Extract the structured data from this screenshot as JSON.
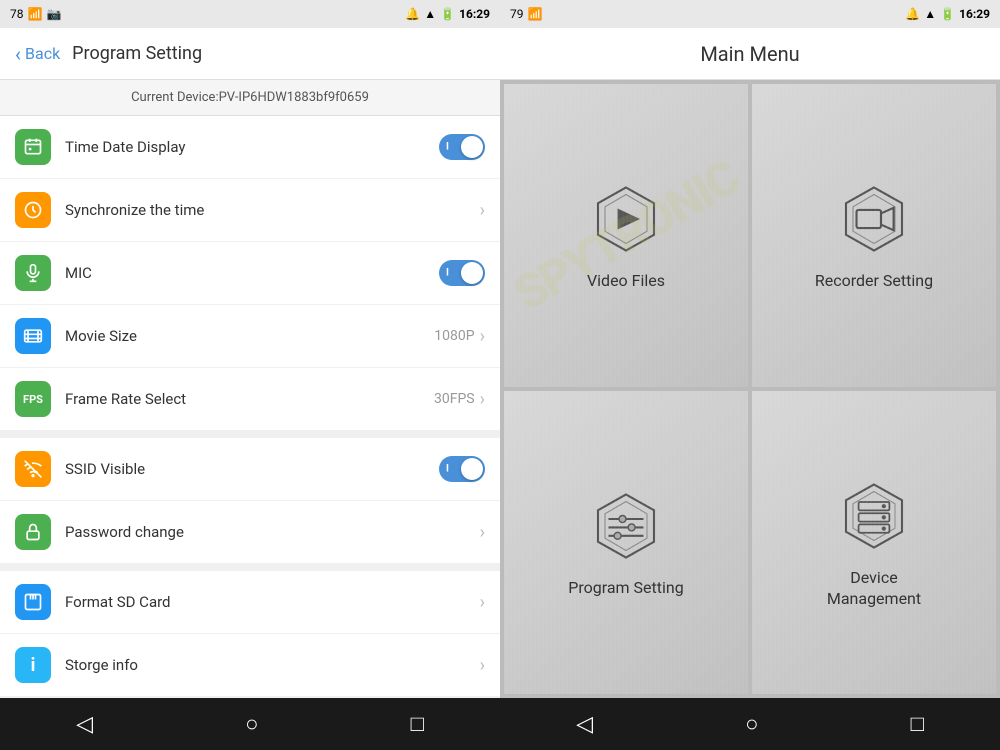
{
  "left": {
    "statusBar": {
      "left": "78",
      "time": "16:29"
    },
    "topBar": {
      "backLabel": "Back",
      "title": "Program Setting"
    },
    "deviceBar": {
      "label": "Current Device:PV-IP6HDW1883bf9f0659"
    },
    "groups": [
      {
        "id": "group1",
        "items": [
          {
            "id": "time-date",
            "icon": "calendar",
            "iconColor": "green",
            "label": "Time Date Display",
            "control": "toggle-on"
          },
          {
            "id": "sync-time",
            "icon": "clock",
            "iconColor": "orange",
            "label": "Synchronize the time",
            "control": "chevron"
          },
          {
            "id": "mic",
            "icon": "mic",
            "iconColor": "green",
            "label": "MIC",
            "control": "toggle-on"
          },
          {
            "id": "movie-size",
            "icon": "film",
            "iconColor": "blue",
            "label": "Movie Size",
            "value": "1080P",
            "control": "chevron"
          },
          {
            "id": "frame-rate",
            "icon": "fps",
            "iconColor": "green",
            "label": "Frame Rate Select",
            "value": "30FPS",
            "control": "chevron"
          }
        ]
      },
      {
        "id": "group2",
        "items": [
          {
            "id": "ssid",
            "icon": "wifi",
            "iconColor": "orange",
            "label": "SSID Visible",
            "control": "toggle-on"
          },
          {
            "id": "password",
            "icon": "lock",
            "iconColor": "green",
            "label": "Password change",
            "control": "chevron"
          }
        ]
      },
      {
        "id": "group3",
        "items": [
          {
            "id": "format-sd",
            "icon": "sd",
            "iconColor": "blue",
            "label": "Format SD Card",
            "control": "chevron"
          },
          {
            "id": "storage",
            "icon": "info",
            "iconColor": "blue",
            "label": "Storge info",
            "control": "chevron"
          }
        ]
      }
    ],
    "nav": {
      "back": "◁",
      "home": "○",
      "recent": "□"
    }
  },
  "right": {
    "statusBar": {
      "left": "79",
      "time": "16:29"
    },
    "title": "Main Menu",
    "menuItems": [
      {
        "id": "video-files",
        "label": "Video Files",
        "icon": "play"
      },
      {
        "id": "recorder-setting",
        "label": "Recorder Setting",
        "icon": "recorder"
      },
      {
        "id": "program-setting",
        "label": "Program Setting",
        "icon": "sliders"
      },
      {
        "id": "device-management",
        "label": "Device\nManagement",
        "icon": "server"
      }
    ],
    "watermark": "SPYTRONIC",
    "nav": {
      "back": "◁",
      "home": "○",
      "recent": "□"
    }
  }
}
